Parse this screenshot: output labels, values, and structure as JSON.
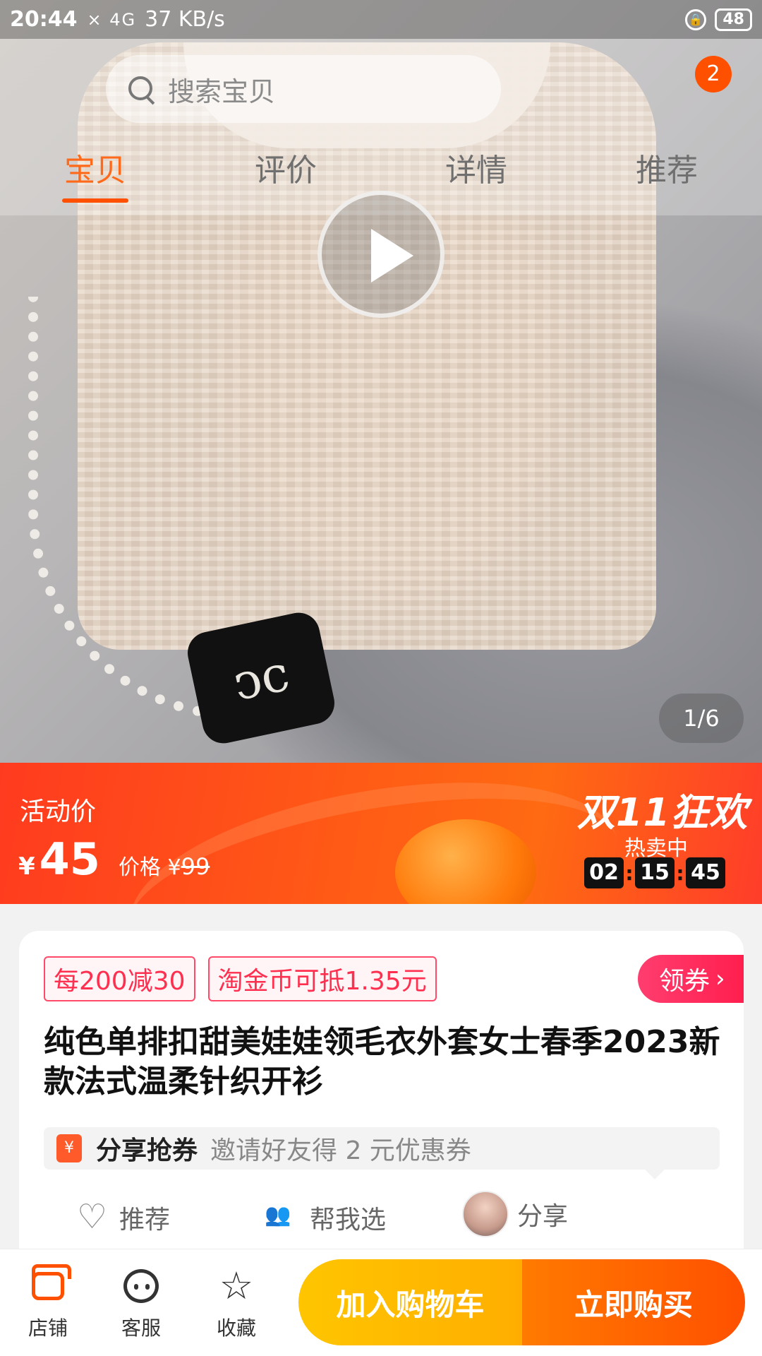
{
  "status_bar": {
    "time": "20:44",
    "signal": "× 4G",
    "speed": "37 KB/s",
    "battery": "48"
  },
  "header": {
    "search_placeholder": "搜索宝贝",
    "message_badge": "2",
    "tabs": [
      {
        "label": "宝贝",
        "active": true
      },
      {
        "label": "评价",
        "active": false
      },
      {
        "label": "详情",
        "active": false
      },
      {
        "label": "推荐",
        "active": false
      }
    ]
  },
  "gallery": {
    "page_indicator": "1/6",
    "play_icon": "play-icon"
  },
  "promo": {
    "activity_label": "活动价",
    "currency": "¥",
    "price": "45",
    "original_label": "价格",
    "original_currency": "¥",
    "original_price": "99",
    "event_name": "双11狂欢",
    "hot_label": "热卖中",
    "countdown": {
      "h": "02",
      "m": "15",
      "s": "45"
    }
  },
  "product": {
    "tags": [
      "每200减30",
      "淘金币可抵1.35元"
    ],
    "coupon_button": "领券",
    "title": "纯色单排扣甜美娃娃领毛衣外套女士春季2023新款法式温柔针织开衫",
    "share_coupon": {
      "icon_text": "¥",
      "label": "分享抢券",
      "text": "邀请好友得 2 元优惠券"
    },
    "actions": {
      "recommend": "推荐",
      "help_choose": "帮我选",
      "share": "分享"
    }
  },
  "bottom_bar": {
    "shop": "店铺",
    "service": "客服",
    "favorite": "收藏",
    "add_to_cart": "加入购物车",
    "buy_now": "立即购买"
  },
  "colors": {
    "accent": "#ff5000",
    "tag_red": "#ff2f4f",
    "cart_yellow": "#ffc500"
  }
}
